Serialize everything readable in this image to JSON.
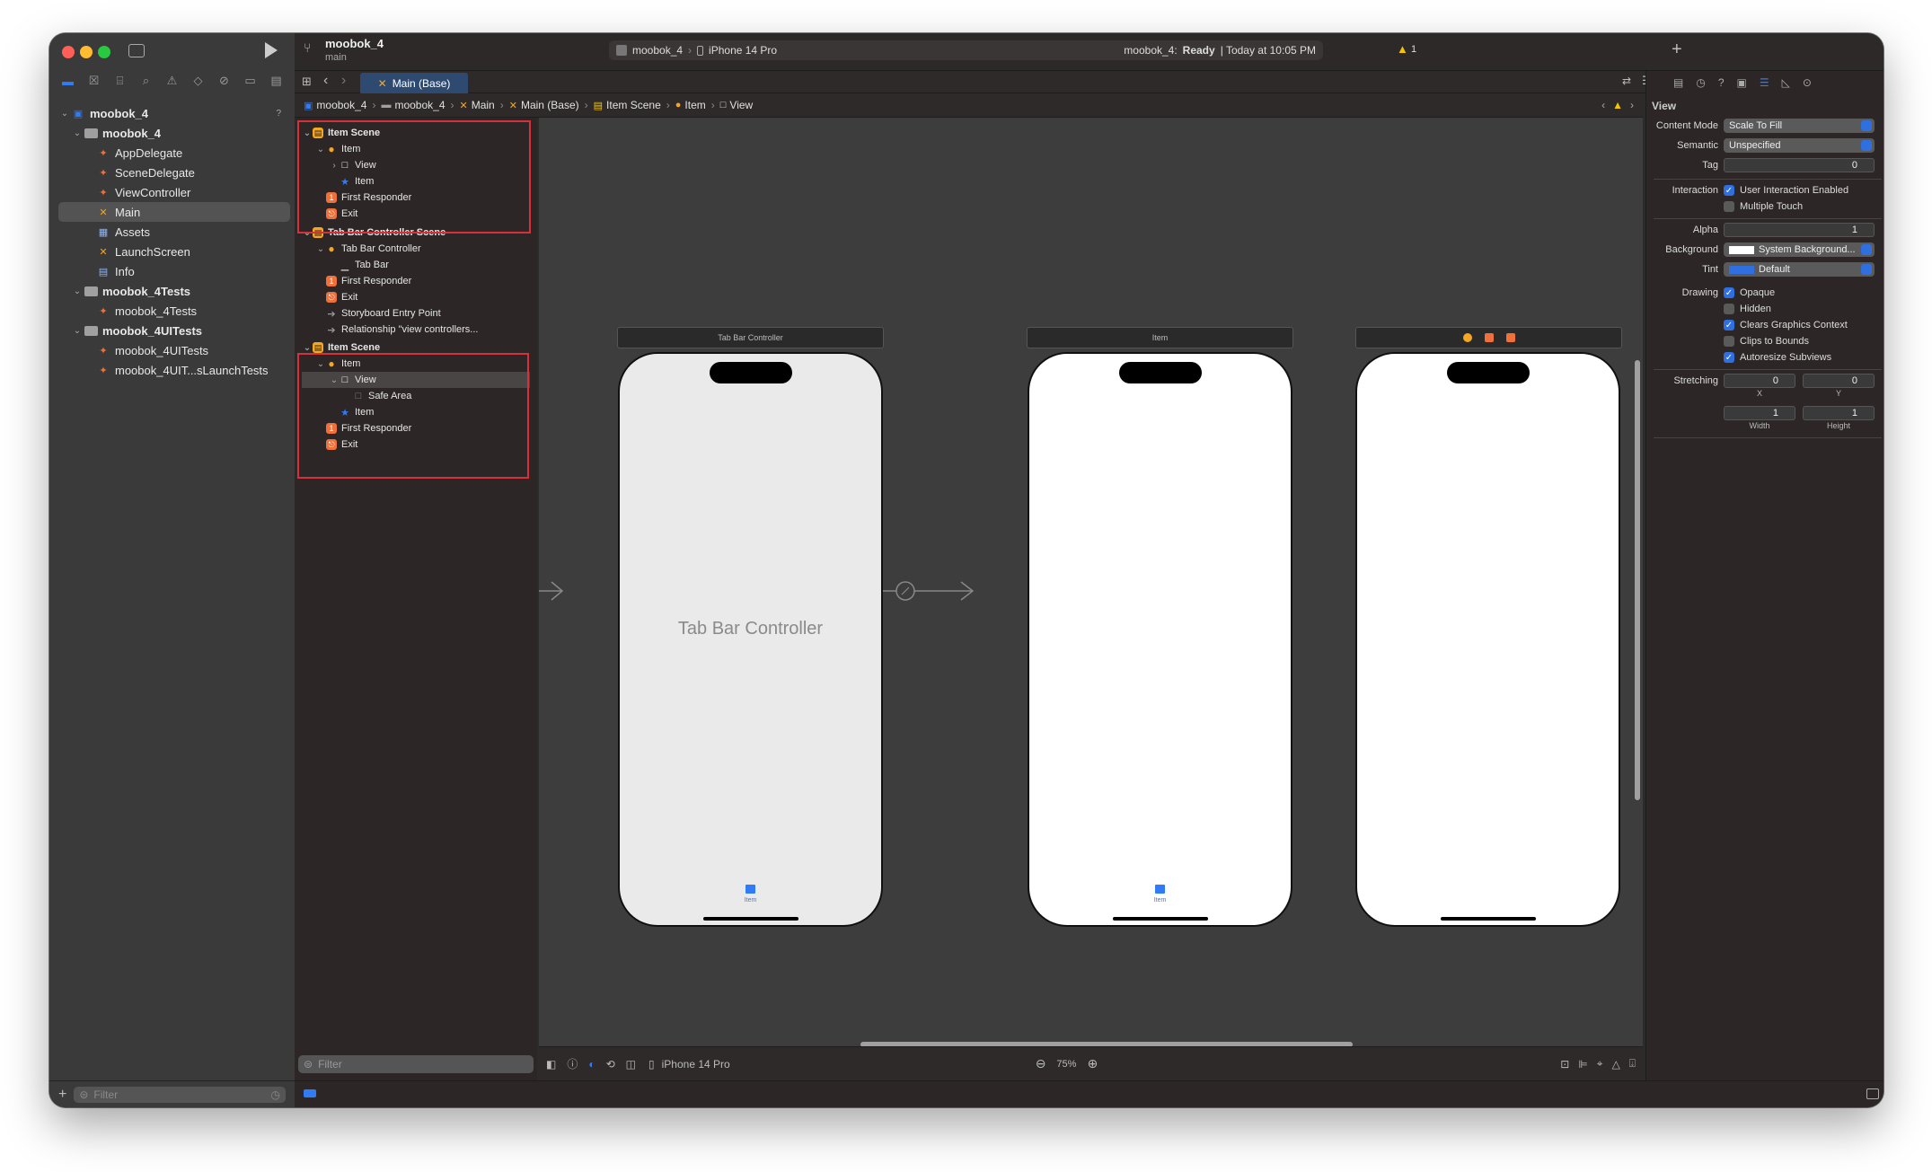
{
  "window": {
    "project": "moobok_4",
    "branch": "main",
    "scheme": "moobok_4",
    "device": "iPhone 14 Pro",
    "status_app": "moobok_4:",
    "status_state": "Ready",
    "status_time": "| Today at 10:05 PM",
    "warning_count": "1"
  },
  "tab": {
    "label": "Main (Base)"
  },
  "navigator": {
    "items": [
      {
        "label": "moobok_4",
        "level": 0,
        "type": "project",
        "expanded": true,
        "badge": "?"
      },
      {
        "label": "moobok_4",
        "level": 1,
        "type": "folder",
        "expanded": true
      },
      {
        "label": "AppDelegate",
        "level": 2,
        "type": "swift"
      },
      {
        "label": "SceneDelegate",
        "level": 2,
        "type": "swift"
      },
      {
        "label": "ViewController",
        "level": 2,
        "type": "swift"
      },
      {
        "label": "Main",
        "level": 2,
        "type": "storyboard",
        "selected": true
      },
      {
        "label": "Assets",
        "level": 2,
        "type": "assets"
      },
      {
        "label": "LaunchScreen",
        "level": 2,
        "type": "storyboard"
      },
      {
        "label": "Info",
        "level": 2,
        "type": "plist"
      },
      {
        "label": "moobok_4Tests",
        "level": 1,
        "type": "folder",
        "expanded": true
      },
      {
        "label": "moobok_4Tests",
        "level": 2,
        "type": "swift"
      },
      {
        "label": "moobok_4UITests",
        "level": 1,
        "type": "folder",
        "expanded": true
      },
      {
        "label": "moobok_4UITests",
        "level": 2,
        "type": "swift"
      },
      {
        "label": "moobok_4UIT...sLaunchTests",
        "level": 2,
        "type": "swift"
      }
    ],
    "filter_placeholder": "Filter"
  },
  "breadcrumb": [
    "moobok_4",
    "moobok_4",
    "Main",
    "Main (Base)",
    "Item Scene",
    "Item",
    "View"
  ],
  "outline": {
    "rows": [
      {
        "label": "Item Scene",
        "level": 0,
        "icon": "scene",
        "chev": "v",
        "bold": true
      },
      {
        "label": "Item",
        "level": 1,
        "icon": "vc",
        "chev": "v"
      },
      {
        "label": "View",
        "level": 2,
        "icon": "view",
        "chev": ">"
      },
      {
        "label": "Item",
        "level": 2,
        "icon": "star"
      },
      {
        "label": "First Responder",
        "level": 1,
        "icon": "responder"
      },
      {
        "label": "Exit",
        "level": 1,
        "icon": "exit"
      },
      {
        "label": "Tab Bar Controller Scene",
        "level": 0,
        "icon": "scene",
        "chev": "v",
        "bold": true
      },
      {
        "label": "Tab Bar Controller",
        "level": 1,
        "icon": "tbc",
        "chev": "v"
      },
      {
        "label": "Tab Bar",
        "level": 2,
        "icon": "tabbar"
      },
      {
        "label": "First Responder",
        "level": 1,
        "icon": "responder"
      },
      {
        "label": "Exit",
        "level": 1,
        "icon": "exit"
      },
      {
        "label": "Storyboard Entry Point",
        "level": 1,
        "icon": "entry"
      },
      {
        "label": "Relationship \"view controllers...",
        "level": 1,
        "icon": "entry"
      },
      {
        "label": "Item Scene",
        "level": 0,
        "icon": "scene",
        "chev": "v",
        "bold": true
      },
      {
        "label": "Item",
        "level": 1,
        "icon": "vc",
        "chev": "v"
      },
      {
        "label": "View",
        "level": 2,
        "icon": "view",
        "chev": "v",
        "selected": true
      },
      {
        "label": "Safe Area",
        "level": 3,
        "icon": "safe"
      },
      {
        "label": "Item",
        "level": 2,
        "icon": "star"
      },
      {
        "label": "First Responder",
        "level": 1,
        "icon": "responder"
      },
      {
        "label": "Exit",
        "level": 1,
        "icon": "exit"
      }
    ],
    "filter_placeholder": "Filter"
  },
  "canvas": {
    "tbc_header": "Tab Bar Controller",
    "tbc_body": "Tab Bar Controller",
    "item_header": "Item",
    "tab_item_label": "Item",
    "device": "iPhone 14 Pro",
    "zoom": "75%"
  },
  "inspector": {
    "section": "View",
    "content_mode_label": "Content Mode",
    "content_mode": "Scale To Fill",
    "semantic_label": "Semantic",
    "semantic": "Unspecified",
    "tag_label": "Tag",
    "tag": "0",
    "interaction_label": "Interaction",
    "user_interaction": "User Interaction Enabled",
    "multiple_touch": "Multiple Touch",
    "alpha_label": "Alpha",
    "alpha": "1",
    "background_label": "Background",
    "background": "System Background...",
    "tint_label": "Tint",
    "tint": "Default",
    "drawing_label": "Drawing",
    "opaque": "Opaque",
    "hidden": "Hidden",
    "clears": "Clears Graphics Context",
    "clips": "Clips to Bounds",
    "autoresize": "Autoresize Subviews",
    "stretching_label": "Stretching",
    "x": "0",
    "y": "0",
    "x_label": "X",
    "y_label": "Y",
    "width": "1",
    "height": "1",
    "width_label": "Width",
    "height_label": "Height",
    "checks": {
      "user_interaction": true,
      "multiple_touch": false,
      "opaque": true,
      "hidden": false,
      "clears": true,
      "clips": false,
      "autoresize": true
    }
  },
  "colors": {
    "accent": "#2f7cf6",
    "selection_outline": "#d6303a",
    "canvas": "#3d3d3d"
  }
}
